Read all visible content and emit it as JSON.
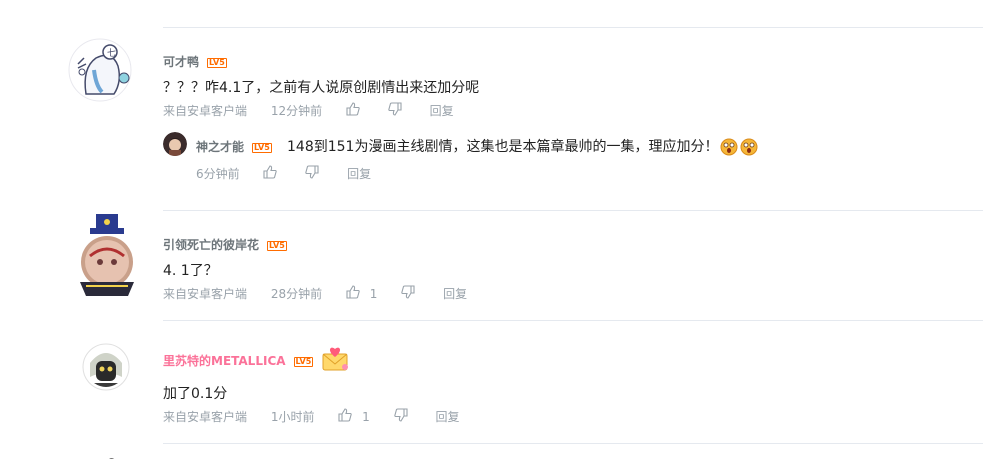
{
  "comments": [
    {
      "user": "可才鸭",
      "level": "LV5",
      "text": "？？？咋4.1了，之前有人说原创剧情出来还加分呢",
      "source": "来自安卓客户端",
      "time": "12分钟前",
      "reply_label": "回复",
      "reply": {
        "user": "神之才能",
        "level": "LV5",
        "text": "148到151为漫画主线剧情，这集也是本篇章最帅的一集，理应加分！",
        "emoji_icons": [
          "shocked-face-emoji",
          "shocked-face-emoji"
        ],
        "time": "6分钟前",
        "reply_label": "回复"
      }
    },
    {
      "user": "引领死亡的彼岸花",
      "level": "LV5",
      "text": "4. 1了？",
      "source": "来自安卓客户端",
      "time": "28分钟前",
      "likes": "1",
      "reply_label": "回复"
    },
    {
      "user": "里苏特的METALLICA",
      "level": "LV5",
      "badge_icon": "love-letter-badge",
      "user_color": "#fb7299",
      "text": "加了0.1分",
      "source": "来自安卓客户端",
      "time": "1小时前",
      "likes": "1",
      "reply_label": "回复"
    }
  ],
  "colors": {
    "meta": "#99a2aa",
    "divider": "#e5e9ef",
    "level": "#ff6c00",
    "vip_name": "#fb7299"
  }
}
